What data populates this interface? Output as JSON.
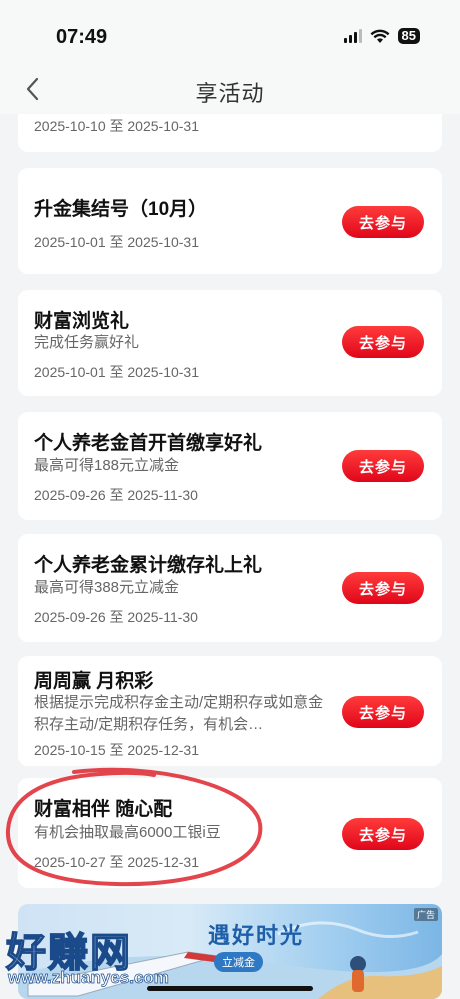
{
  "status_bar": {
    "time": "07:49",
    "battery": "85"
  },
  "nav": {
    "title": "享活动"
  },
  "button_label": "去参与",
  "cards": [
    {
      "title": "",
      "desc": "",
      "date": "2025-10-10 至 2025-10-31"
    },
    {
      "title": "升金集结号（10月）",
      "desc": "",
      "date": "2025-10-01 至 2025-10-31"
    },
    {
      "title": "财富浏览礼",
      "desc": "完成任务赢好礼",
      "date": "2025-10-01 至 2025-10-31"
    },
    {
      "title": "个人养老金首开首缴享好礼",
      "desc": "最高可得188元立减金",
      "date": "2025-09-26 至 2025-11-30"
    },
    {
      "title": "个人养老金累计缴存礼上礼",
      "desc": "最高可得388元立减金",
      "date": "2025-09-26 至 2025-11-30"
    },
    {
      "title": "周周赢 月积彩",
      "desc": "根据提示完成积存金主动/定期积存或如意金积存主动/定期积存任务，有机会…",
      "date": "2025-10-15 至 2025-12-31"
    },
    {
      "title": "财富相伴 随心配",
      "desc": "有机会抽取最高6000工银i豆",
      "date": "2025-10-27 至 2025-12-31"
    }
  ],
  "ad": {
    "tag": "广告",
    "title": "遇好时光",
    "subtitle": "立减金"
  },
  "watermark": {
    "text": "好赚网",
    "url": "www.zhuanyes.com"
  },
  "colors": {
    "button_red": "#e0061a",
    "circle_red": "#e0313a",
    "background": "#f3f4f6"
  }
}
